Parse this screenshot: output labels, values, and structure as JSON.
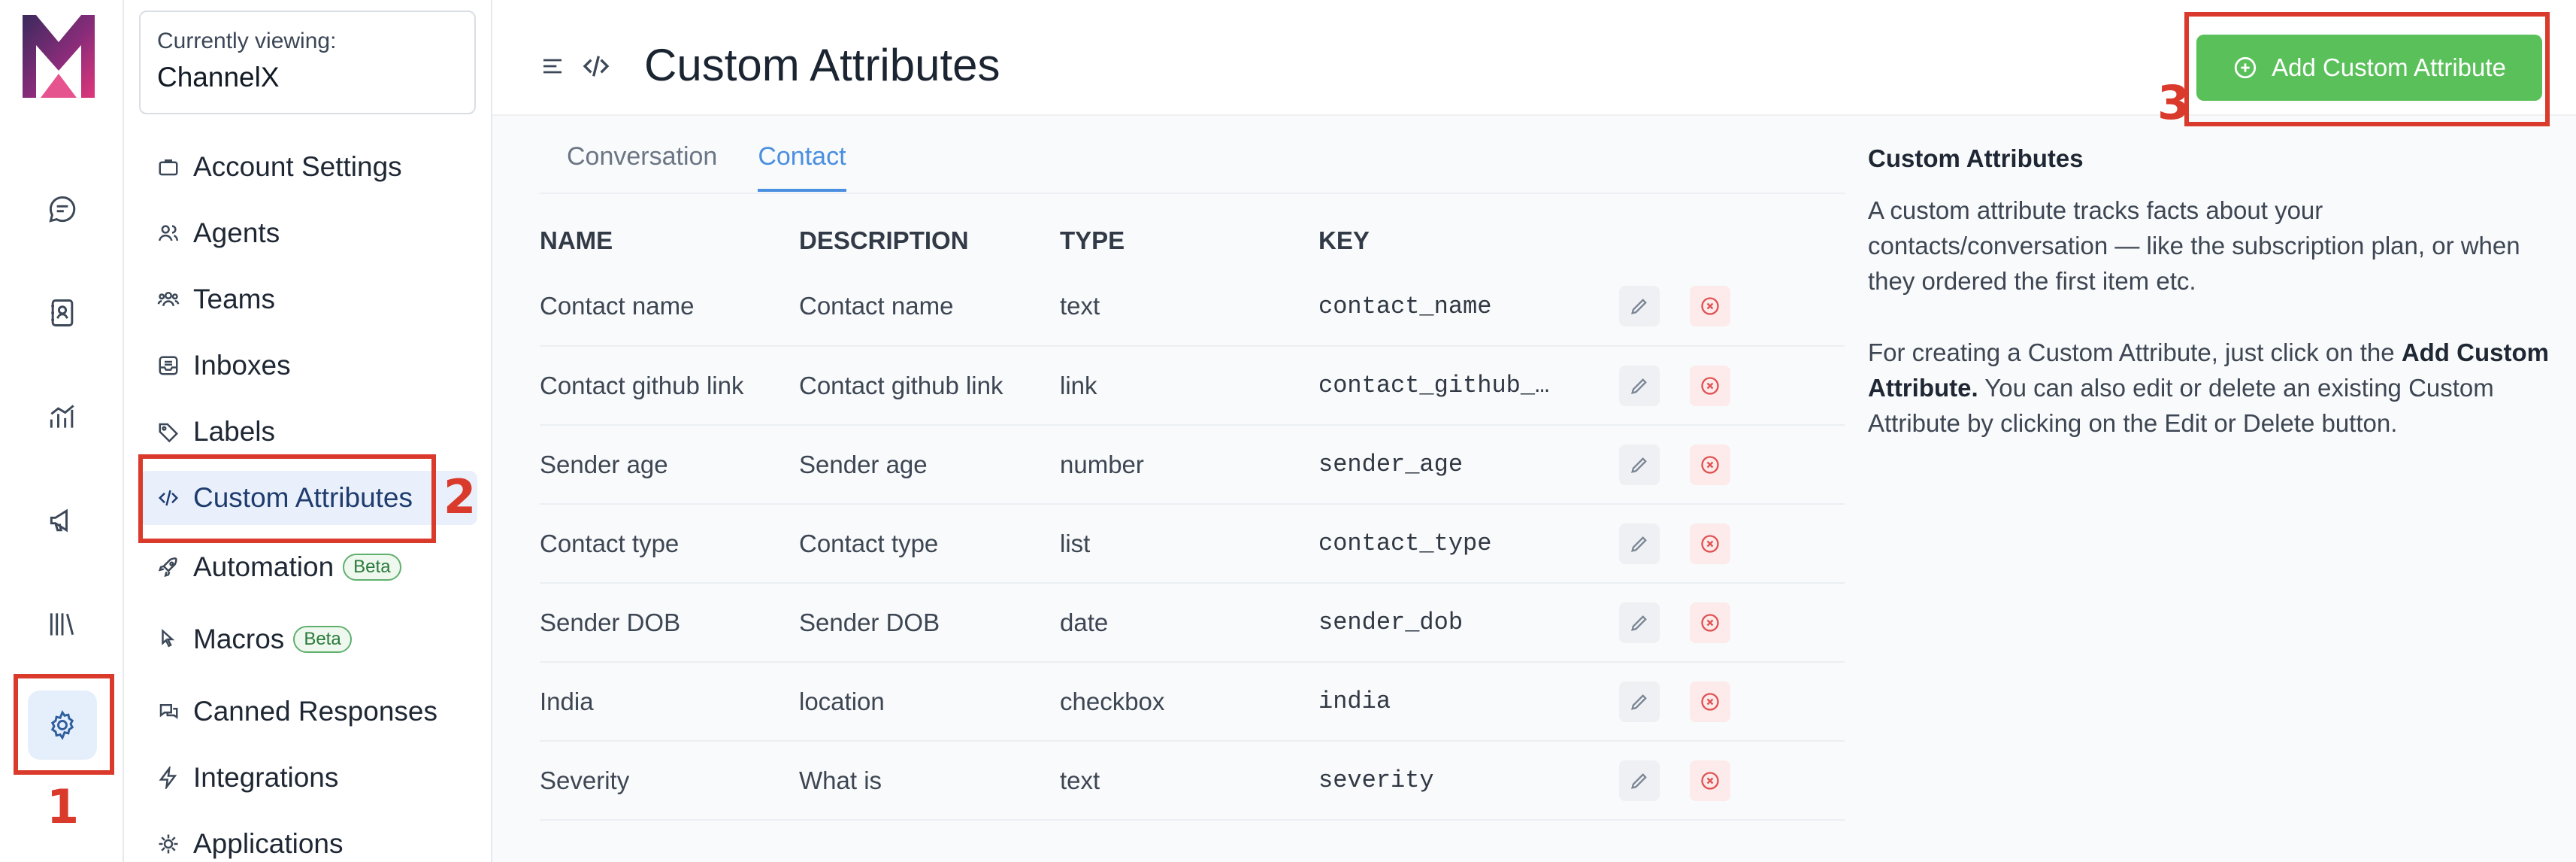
{
  "rail": {
    "items": [
      {
        "name": "conversations-icon"
      },
      {
        "name": "contacts-icon"
      },
      {
        "name": "reports-icon"
      },
      {
        "name": "campaigns-icon"
      },
      {
        "name": "library-icon"
      },
      {
        "name": "settings-icon",
        "active": true
      }
    ]
  },
  "sidebar": {
    "account_caption": "Currently viewing:",
    "account_name": "ChannelX",
    "items": [
      {
        "label": "Account Settings",
        "icon": "briefcase-icon"
      },
      {
        "label": "Agents",
        "icon": "agents-icon"
      },
      {
        "label": "Teams",
        "icon": "teams-icon"
      },
      {
        "label": "Inboxes",
        "icon": "inbox-icon"
      },
      {
        "label": "Labels",
        "icon": "tag-icon"
      },
      {
        "label": "Custom Attributes",
        "icon": "code-icon",
        "active": true
      },
      {
        "label": "Automation",
        "icon": "rocket-icon",
        "badge": "Beta"
      },
      {
        "label": "Macros",
        "icon": "macros-icon",
        "badge": "Beta"
      },
      {
        "label": "Canned Responses",
        "icon": "chat-bubbles-icon"
      },
      {
        "label": "Integrations",
        "icon": "lightning-icon"
      },
      {
        "label": "Applications",
        "icon": "applications-icon"
      }
    ]
  },
  "header": {
    "title": "Custom Attributes",
    "add_button": "Add Custom Attribute"
  },
  "tabs": [
    {
      "label": "Conversation",
      "active": false
    },
    {
      "label": "Contact",
      "active": true
    }
  ],
  "table": {
    "columns": [
      "NAME",
      "DESCRIPTION",
      "TYPE",
      "KEY"
    ],
    "rows": [
      {
        "name": "Contact name",
        "description": "Contact name",
        "type": "text",
        "key": "contact_name"
      },
      {
        "name": "Contact github link",
        "description": "Contact github link",
        "type": "link",
        "key": "contact_github_…"
      },
      {
        "name": "Sender age",
        "description": "Sender age",
        "type": "number",
        "key": "sender_age"
      },
      {
        "name": "Contact type",
        "description": "Contact type",
        "type": "list",
        "key": "contact_type"
      },
      {
        "name": "Sender DOB",
        "description": "Sender DOB",
        "type": "date",
        "key": "sender_dob"
      },
      {
        "name": "India",
        "description": "location",
        "type": "checkbox",
        "key": "india"
      },
      {
        "name": "Severity",
        "description": "What is",
        "type": "text",
        "key": "severity"
      }
    ]
  },
  "help": {
    "title": "Custom Attributes",
    "p1": "A custom attribute tracks facts about your contacts/conversation — like the subscription plan, or when they ordered the first item etc.",
    "p2_pre": "For creating a Custom Attribute, just click on the ",
    "p2_bold": "Add Custom Attribute.",
    "p2_post": " You can also edit or delete an existing Custom Attribute by clicking on the Edit or Delete button."
  },
  "annotations": [
    "1",
    "2",
    "3"
  ],
  "colors": {
    "accent": "#4a8fe0",
    "primary_button": "#5ac05a",
    "annotation": "#d93a2b",
    "delete": "#e05252"
  }
}
